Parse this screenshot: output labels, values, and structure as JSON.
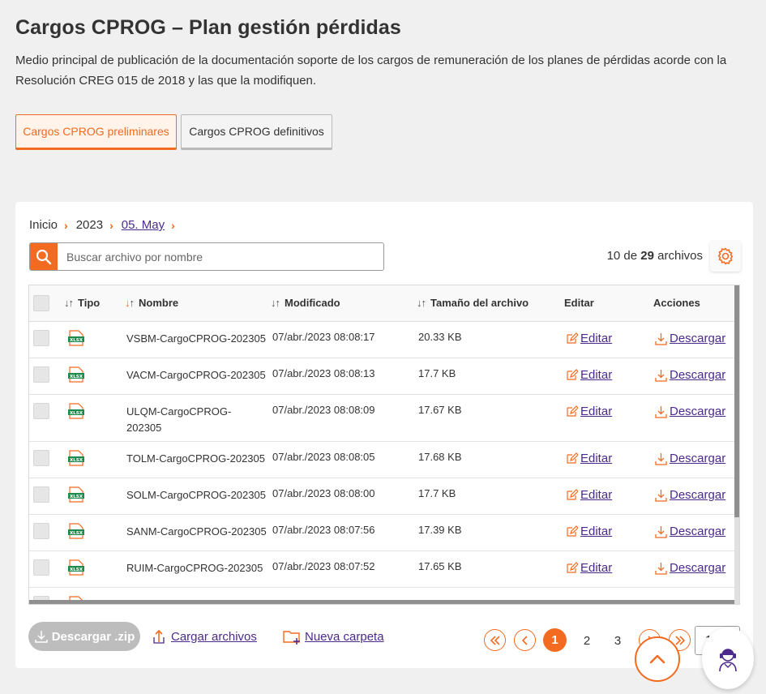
{
  "page": {
    "title": "Cargos CPROG – Plan gestión pérdidas",
    "description": "Medio principal de publicación de la documentación soporte de los cargos de remuneración de los planes de pérdidas acorde con la Resolución CREG 015 de 2018 y las que la modifiquen."
  },
  "tabs": [
    {
      "label": "Cargos CPROG preliminares",
      "active": true
    },
    {
      "label": "Cargos CPROG definitivos",
      "active": false
    }
  ],
  "breadcrumb": {
    "items": [
      "Inicio",
      "2023",
      "05. May"
    ]
  },
  "search": {
    "placeholder": "Buscar archivo por nombre"
  },
  "file_count": {
    "prefix": "10 de",
    "total": "29",
    "suffix": "archivos"
  },
  "table": {
    "headers": {
      "tipo": "Tipo",
      "nombre": "Nombre",
      "modificado": "Modificado",
      "tamano": "Tamaño del archivo",
      "editar": "Editar",
      "acciones": "Acciones"
    },
    "edit_label": "Editar",
    "download_label": "Descargar",
    "file_icon_text": "XLSX",
    "rows": [
      {
        "name": "VSBM-CargoCPROG-202305",
        "modified": "07/abr./2023 08:08:17",
        "size": "20.33 KB"
      },
      {
        "name": "VACM-CargoCPROG-202305",
        "modified": "07/abr./2023 08:08:13",
        "size": "17.7 KB"
      },
      {
        "name": "ULQM-CargoCPROG-",
        "name2": "202305",
        "modified": "07/abr./2023 08:08:09",
        "size": "17.67 KB"
      },
      {
        "name": "TOLM-CargoCPROG-202305",
        "modified": "07/abr./2023 08:08:05",
        "size": "17.68 KB"
      },
      {
        "name": "SOLM-CargoCPROG-202305",
        "modified": "07/abr./2023 08:08:00",
        "size": "17.7 KB"
      },
      {
        "name": "SANM-CargoCPROG-202305",
        "modified": "07/abr./2023 08:07:56",
        "size": "17.39 KB"
      },
      {
        "name": "RUIM-CargoCPROG-202305",
        "modified": "07/abr./2023 08:07:52",
        "size": "17.65 KB"
      }
    ]
  },
  "footer": {
    "zip_label": "Descargar .zip",
    "upload_label": "Cargar archivos",
    "new_folder_label": "Nueva carpeta"
  },
  "pagination": {
    "pages": [
      "1",
      "2",
      "3"
    ],
    "current": "1",
    "page_size": "10"
  },
  "colors": {
    "accent": "#f26b21",
    "link": "#4b2a8c"
  }
}
